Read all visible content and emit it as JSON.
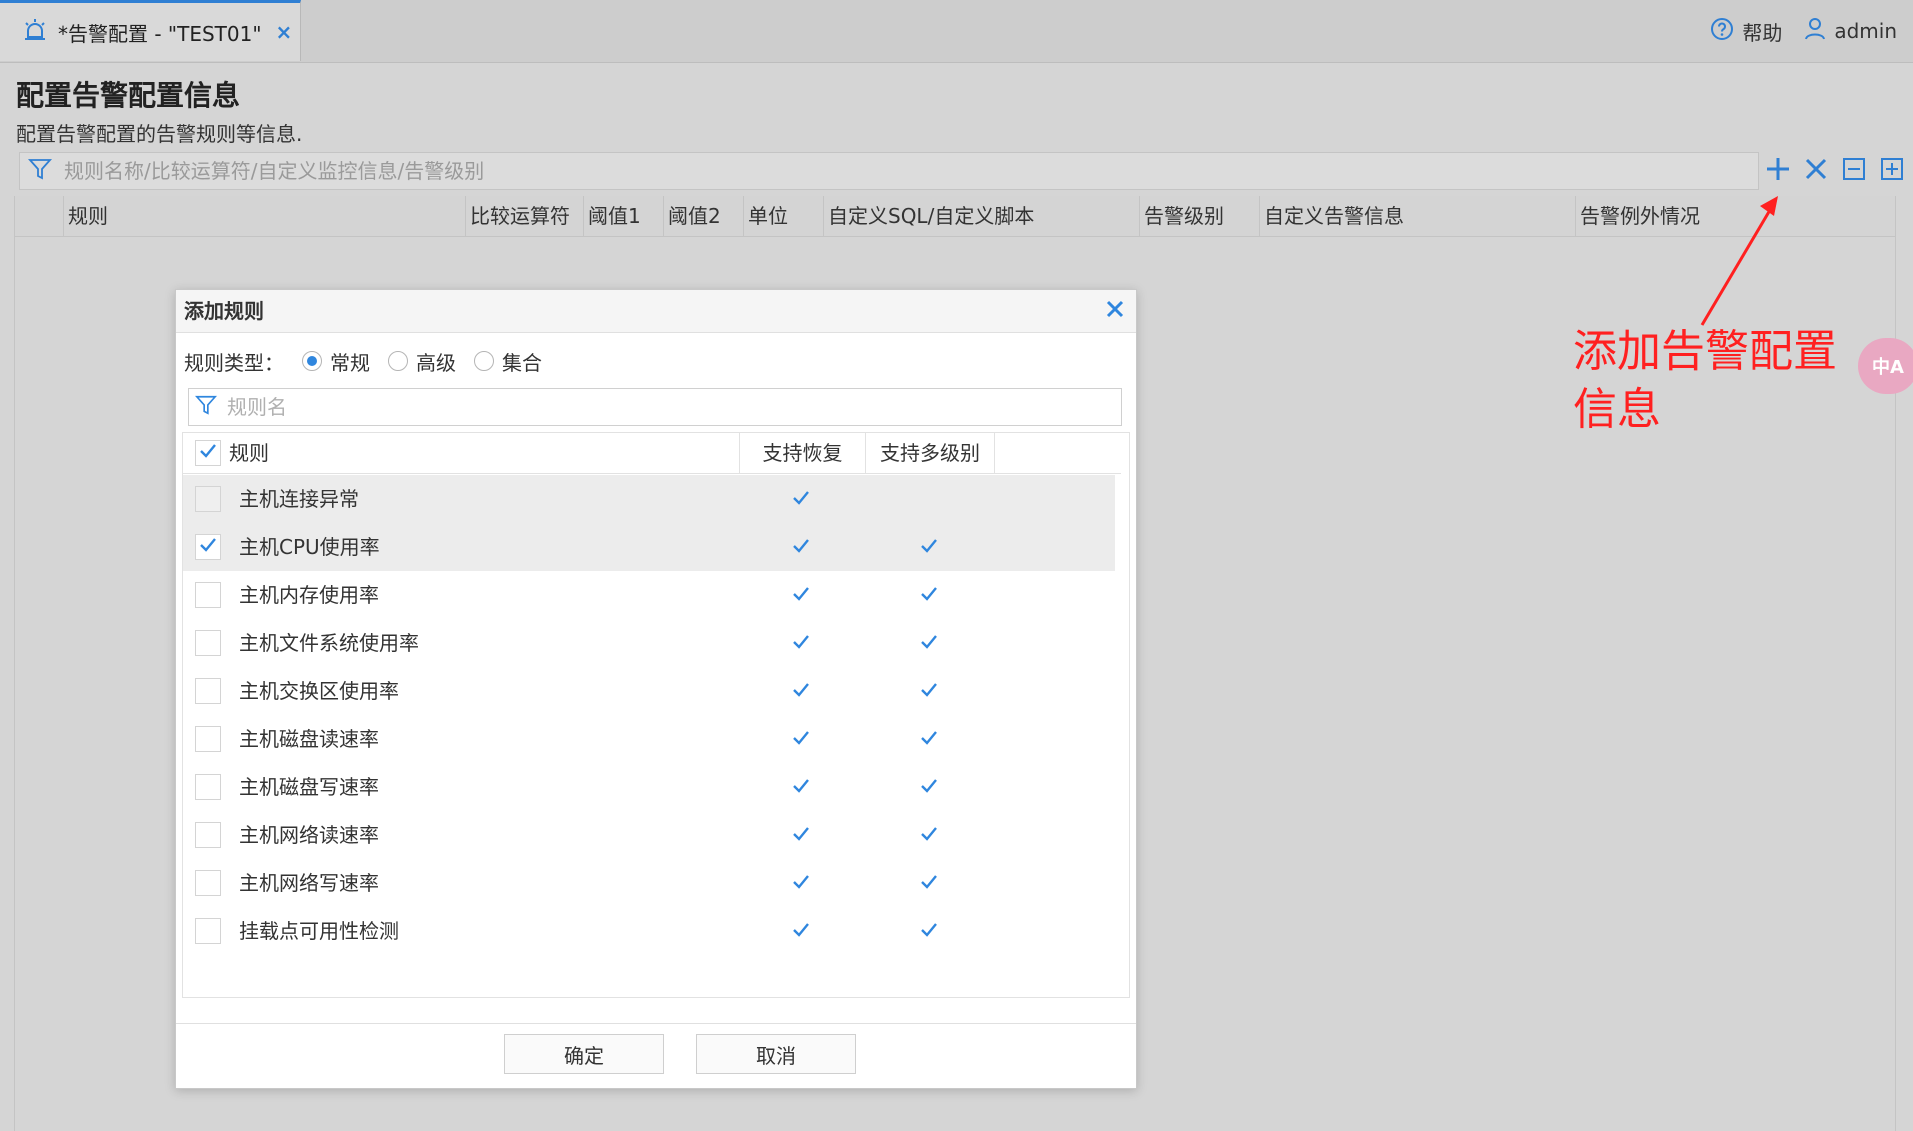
{
  "tab": {
    "label": "*告警配置 - \"TEST01\"",
    "close": "×"
  },
  "top": {
    "help": "帮助",
    "user": "admin"
  },
  "page": {
    "title": "配置告警配置信息",
    "subtitle": "配置告警配置的告警规则等信息.",
    "filter_placeholder": "规则名称/比较运算符/自定义监控信息/告警级别"
  },
  "grid": {
    "columns": [
      "规则",
      "比较运算符",
      "阈值1",
      "阈值2",
      "单位",
      "自定义SQL/自定义脚本",
      "告警级别",
      "自定义告警信息",
      "告警例外情况"
    ]
  },
  "annotation": {
    "text": "添加告警配置\n信息"
  },
  "fab": {
    "label": "中A"
  },
  "dialog": {
    "title": "添加规则",
    "rule_type_label": "规则类型：",
    "rule_types": [
      {
        "label": "常规",
        "selected": true
      },
      {
        "label": "高级",
        "selected": false
      },
      {
        "label": "集合",
        "selected": false
      }
    ],
    "filter_placeholder": "规则名",
    "columns": {
      "rule": "规则",
      "recover": "支持恢复",
      "multi": "支持多级别"
    },
    "rows": [
      {
        "name": "主机连接异常",
        "checked": false,
        "recover": true,
        "multi": false
      },
      {
        "name": "主机CPU使用率",
        "checked": true,
        "recover": true,
        "multi": true
      },
      {
        "name": "主机内存使用率",
        "checked": false,
        "recover": true,
        "multi": true
      },
      {
        "name": "主机文件系统使用率",
        "checked": false,
        "recover": true,
        "multi": true
      },
      {
        "name": "主机交换区使用率",
        "checked": false,
        "recover": true,
        "multi": true
      },
      {
        "name": "主机磁盘读速率",
        "checked": false,
        "recover": true,
        "multi": true
      },
      {
        "name": "主机磁盘写速率",
        "checked": false,
        "recover": true,
        "multi": true
      },
      {
        "name": "主机网络读速率",
        "checked": false,
        "recover": true,
        "multi": true
      },
      {
        "name": "主机网络写速率",
        "checked": false,
        "recover": true,
        "multi": true
      },
      {
        "name": "挂载点可用性检测",
        "checked": false,
        "recover": true,
        "multi": true
      }
    ],
    "ok": "确定",
    "cancel": "取消"
  },
  "colors": {
    "accent": "#2f86de",
    "annotation": "#ff2020"
  }
}
